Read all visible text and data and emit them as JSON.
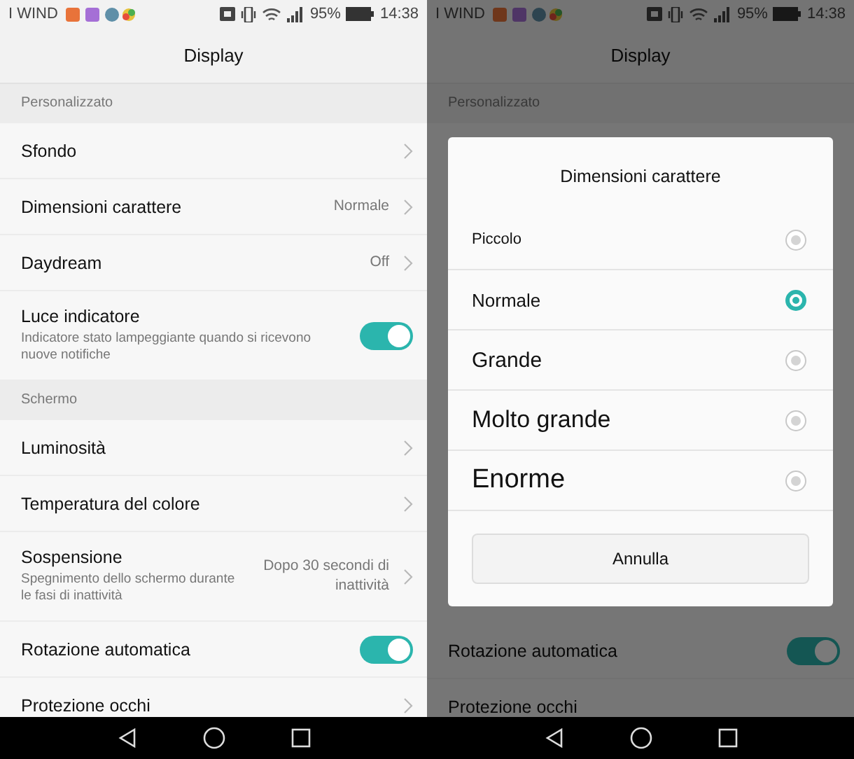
{
  "left_screen": {
    "status_bar": {
      "carrier": "I WIND",
      "battery": "95%",
      "time": "14:38"
    },
    "title": "Display",
    "sections": [
      {
        "header": "Personalizzato",
        "rows": [
          {
            "kind": "link",
            "label": "Sfondo"
          },
          {
            "kind": "link",
            "label": "Dimensioni carattere",
            "value": "Normale"
          },
          {
            "kind": "link",
            "label": "Daydream",
            "value": "Off"
          },
          {
            "kind": "toggle",
            "label": "Luce indicatore",
            "subtitle": "Indicatore stato lampeggiante quando si ricevono nuove notifiche",
            "on": true
          }
        ]
      },
      {
        "header": "Schermo",
        "rows": [
          {
            "kind": "link",
            "label": "Luminosità"
          },
          {
            "kind": "link",
            "label": "Temperatura del colore"
          },
          {
            "kind": "link",
            "label": "Sospensione",
            "subtitle": "Spegnimento dello schermo durante le fasi di inattività",
            "value": "Dopo 30 secondi di inattività"
          },
          {
            "kind": "toggle",
            "label": "Rotazione automatica",
            "on": true
          },
          {
            "kind": "link",
            "label": "Protezione occhi"
          }
        ]
      }
    ]
  },
  "right_screen": {
    "status_bar": {
      "carrier": "I WIND",
      "battery": "95%",
      "time": "14:38"
    },
    "title": "Display",
    "section_header": "Personalizzato",
    "rows": [
      {
        "kind": "toggle",
        "label": "Rotazione automatica",
        "on": true
      },
      {
        "kind": "plain",
        "label": "Protezione occhi"
      }
    ],
    "dialog": {
      "title": "Dimensioni carattere",
      "options": [
        {
          "label": "Piccolo",
          "selected": false
        },
        {
          "label": "Normale",
          "selected": true
        },
        {
          "label": "Grande",
          "selected": false
        },
        {
          "label": "Molto grande",
          "selected": false
        },
        {
          "label": "Enorme",
          "selected": false
        }
      ],
      "cancel": "Annulla"
    }
  }
}
